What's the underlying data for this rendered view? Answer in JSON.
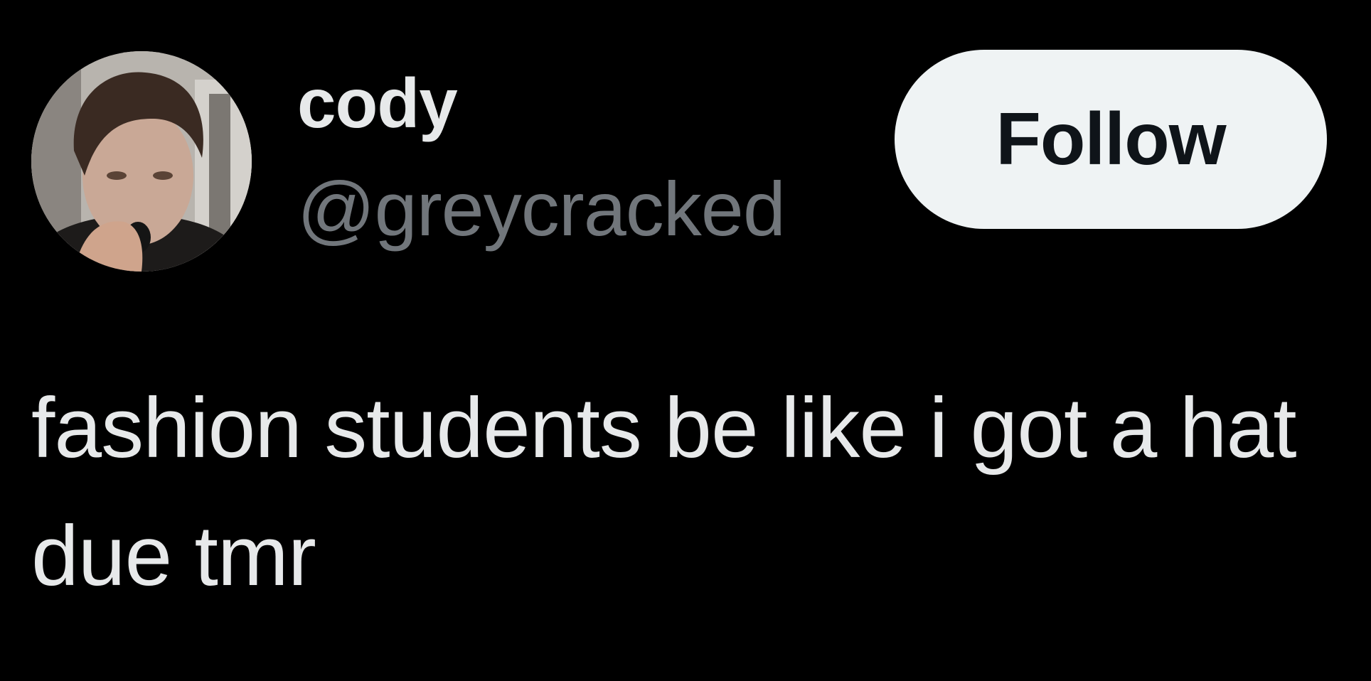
{
  "colors": {
    "background": "#000000",
    "primary_text": "#e7e9ea",
    "secondary_text": "#71767b",
    "follow_button_bg": "#eff3f4",
    "follow_button_text": "#0f1419"
  },
  "author": {
    "avatar_icon": "profile-photo",
    "display_name": "cody",
    "handle": "@greycracked"
  },
  "actions": {
    "follow_label": "Follow"
  },
  "tweet": {
    "text": "fashion students be like i got a hat due tmr"
  }
}
